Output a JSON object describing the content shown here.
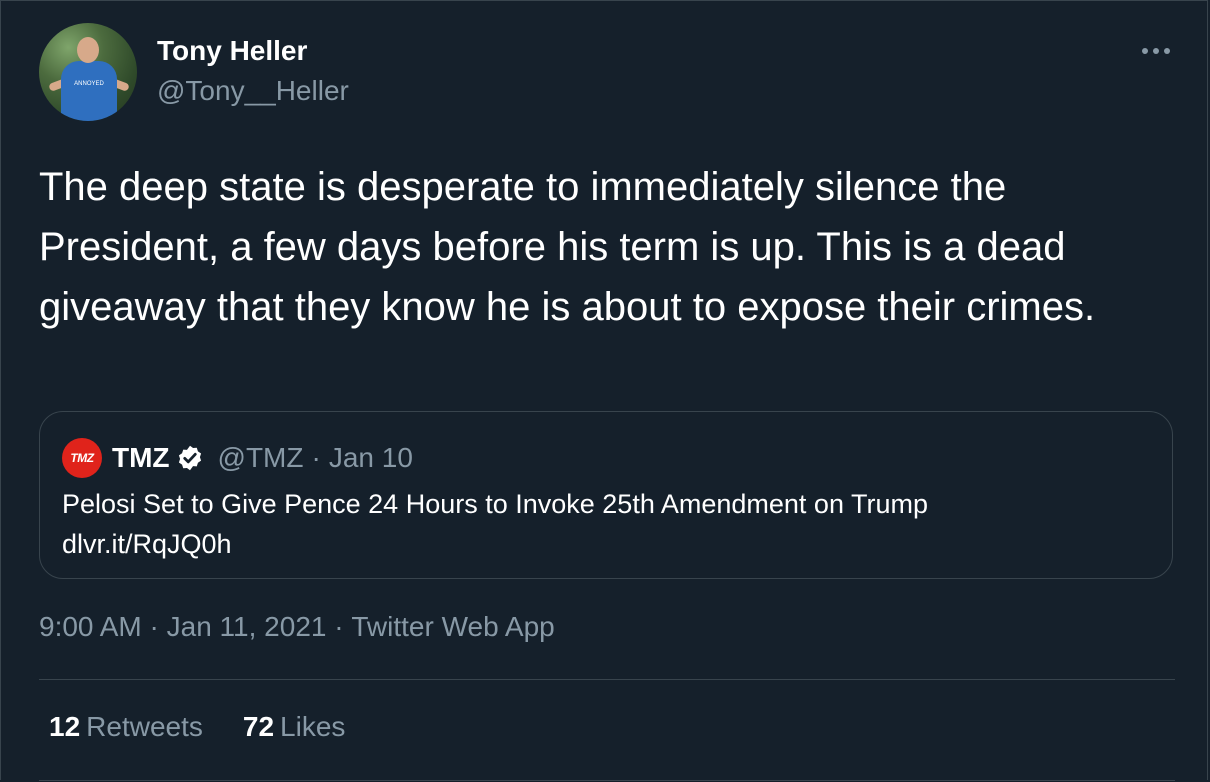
{
  "author": {
    "name": "Tony Heller",
    "handle": "@Tony__Heller",
    "avatar_shirt_text": "ANNOYED"
  },
  "tweet": {
    "text": "The deep state is desperate to immediately silence the President, a few days before his term is up. This is a dead giveaway that they know he is about to expose their crimes."
  },
  "quoted_tweet": {
    "logo_text": "TMZ",
    "name": "TMZ",
    "handle": "@TMZ",
    "separator": "·",
    "date": "Jan 10",
    "text_line1": "Pelosi Set to Give Pence 24 Hours to Invoke 25th Amendment on Trump",
    "text_line2": "dlvr.it/RqJQ0h"
  },
  "meta": {
    "time": "9:00 AM",
    "sep1": " · ",
    "date": "Jan 11, 2021",
    "sep2": " · ",
    "source": "Twitter Web App"
  },
  "stats": {
    "retweets_count": "12",
    "retweets_label": "Retweets",
    "likes_count": "72",
    "likes_label": "Likes"
  },
  "icons": {
    "more": "more-horizontal-icon",
    "verified": "verified-badge-icon"
  },
  "colors": {
    "background": "#15202b",
    "secondary_text": "#8899a6",
    "border": "#38444d",
    "tmz_red": "#e0231b"
  }
}
